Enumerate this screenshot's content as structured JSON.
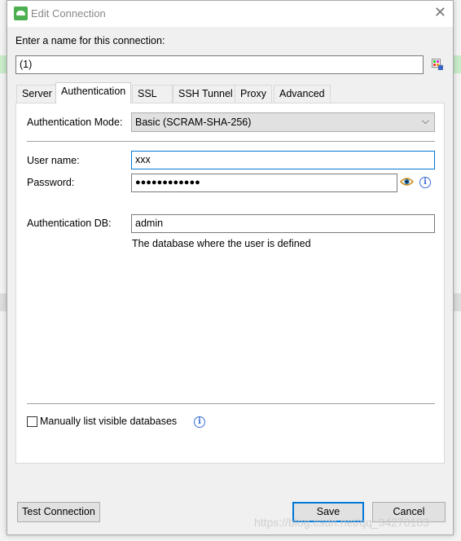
{
  "window": {
    "title": "Edit Connection",
    "close_icon": "close-icon"
  },
  "connection_name": {
    "label": "Enter a name for this connection:",
    "value": "(1)",
    "color_picker_icon": "color-palette-icon"
  },
  "tabs": [
    {
      "label": "Server"
    },
    {
      "label": "Authentication",
      "active": true
    },
    {
      "label": "SSL"
    },
    {
      "label": "SSH Tunnel"
    },
    {
      "label": "Proxy"
    },
    {
      "label": "Advanced"
    }
  ],
  "auth": {
    "mode_label": "Authentication Mode:",
    "mode_value": "Basic (SCRAM-SHA-256)",
    "username_label": "User name:",
    "username_value": "xxx",
    "password_label": "Password:",
    "password_value": "●●●●●●●●●●●●",
    "auth_db_label": "Authentication DB:",
    "auth_db_value": "admin",
    "auth_db_hint": "The database where the user is defined",
    "manual_list_label": "Manually list visible databases",
    "manual_list_checked": false
  },
  "buttons": {
    "test": "Test Connection",
    "save": "Save",
    "cancel": "Cancel"
  },
  "watermark": "https://blog.csdn.net/qq_34270183",
  "colors": {
    "accent": "#0078d7",
    "app_icon": "#4caf50",
    "info": "#3a6fd8"
  }
}
